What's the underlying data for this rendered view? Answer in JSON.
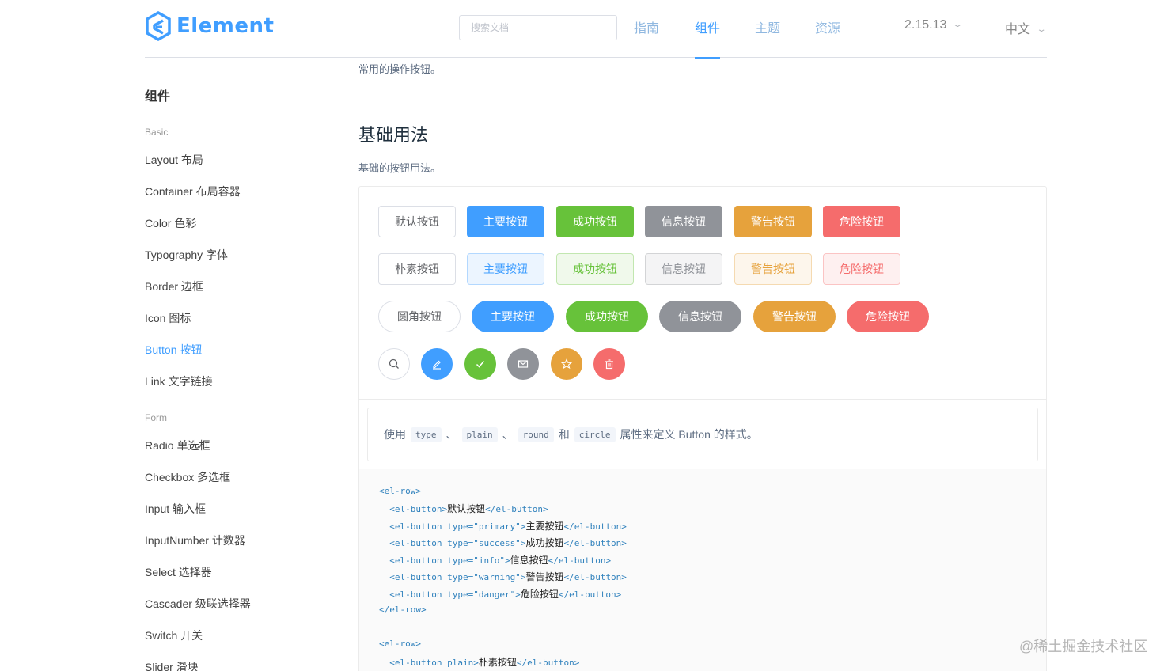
{
  "header": {
    "logo_text": "Element",
    "search_placeholder": "搜索文档",
    "nav": [
      "指南",
      "组件",
      "主题",
      "资源"
    ],
    "active_nav": "组件",
    "version": "2.15.13",
    "lang": "中文",
    "brand_color": "#409eff"
  },
  "sidebar": {
    "title": "组件",
    "groups": [
      {
        "label": "Basic",
        "items": [
          "Layout 布局",
          "Container 布局容器",
          "Color 色彩",
          "Typography 字体",
          "Border 边框",
          "Icon 图标",
          "Button 按钮",
          "Link 文字链接"
        ]
      },
      {
        "label": "Form",
        "items": [
          "Radio 单选框",
          "Checkbox 多选框",
          "Input 输入框",
          "InputNumber 计数器",
          "Select 选择器",
          "Cascader 级联选择器",
          "Switch 开关",
          "Slider 滑块"
        ]
      }
    ],
    "active_item": "Button 按钮"
  },
  "main": {
    "intro": "常用的操作按钮。",
    "section_title": "基础用法",
    "section_desc": "基础的按钮用法。",
    "rows": {
      "default": [
        "默认按钮",
        "主要按钮",
        "成功按钮",
        "信息按钮",
        "警告按钮",
        "危险按钮"
      ],
      "plain": [
        "朴素按钮",
        "主要按钮",
        "成功按钮",
        "信息按钮",
        "警告按钮",
        "危险按钮"
      ],
      "round": [
        "圆角按钮",
        "主要按钮",
        "成功按钮",
        "信息按钮",
        "警告按钮",
        "危险按钮"
      ],
      "circle_icons": [
        "search-icon",
        "edit-icon",
        "check-icon",
        "message-icon",
        "star-icon",
        "delete-icon"
      ]
    },
    "meta": {
      "prefix": "使用",
      "code1": "type",
      "sep1": "、",
      "code2": "plain",
      "sep2": "、",
      "code3": "round",
      "and": "和",
      "code4": "circle",
      "suffix": "属性来定义 Button 的样式。"
    },
    "code_lines": [
      {
        "tag_open": "<el-row>",
        "text": "",
        "tag_close": ""
      },
      {
        "tag_open": "  <el-button>",
        "text": "默认按钮",
        "tag_close": "</el-button>"
      },
      {
        "tag_open": "  <el-button type=\"primary\">",
        "text": "主要按钮",
        "tag_close": "</el-button>"
      },
      {
        "tag_open": "  <el-button type=\"success\">",
        "text": "成功按钮",
        "tag_close": "</el-button>"
      },
      {
        "tag_open": "  <el-button type=\"info\">",
        "text": "信息按钮",
        "tag_close": "</el-button>"
      },
      {
        "tag_open": "  <el-button type=\"warning\">",
        "text": "警告按钮",
        "tag_close": "</el-button>"
      },
      {
        "tag_open": "  <el-button type=\"danger\">",
        "text": "危险按钮",
        "tag_close": "</el-button>"
      },
      {
        "tag_open": "</el-row>",
        "text": "",
        "tag_close": ""
      },
      {
        "tag_open": "",
        "text": "",
        "tag_close": ""
      },
      {
        "tag_open": "<el-row>",
        "text": "",
        "tag_close": ""
      },
      {
        "tag_open": "  <el-button plain>",
        "text": "朴素按钮",
        "tag_close": "</el-button>"
      }
    ]
  },
  "watermark": "@稀土掘金技术社区"
}
